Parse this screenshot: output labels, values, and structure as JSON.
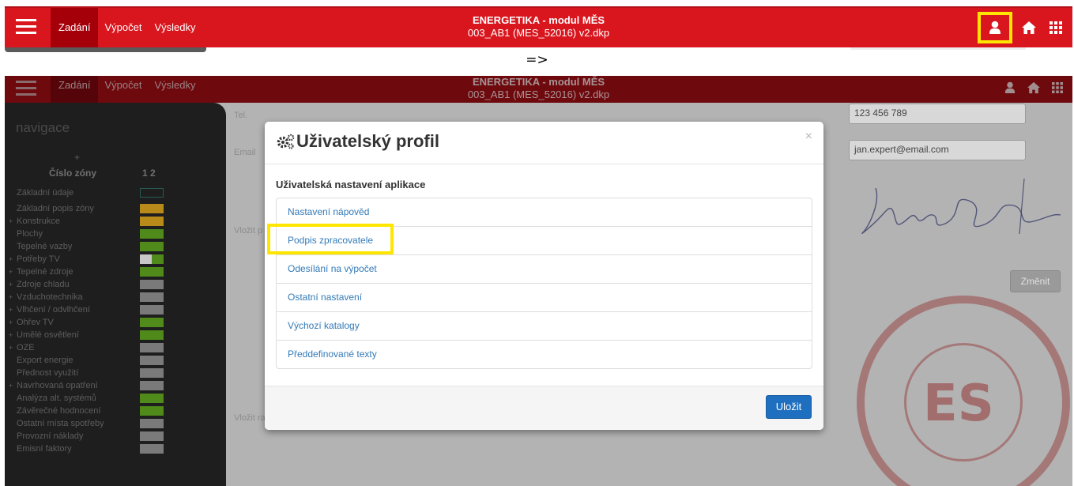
{
  "topbar": {
    "nav": [
      "Zadání",
      "Výpočet",
      "Výsledky"
    ],
    "title": "ENERGETIKA - modul MĚS",
    "subtitle": "003_AB1 (MES_52016) v2.dkp",
    "icons": [
      "menu-icon",
      "user-icon",
      "home-icon",
      "apps-grid-icon"
    ]
  },
  "arrow": "=>",
  "sidebar": {
    "title": "navigace",
    "plus": "+",
    "zone_header": "Číslo zóny",
    "zone_numbers": "1 2",
    "items": [
      {
        "label": "Základní údaje",
        "plus": ""
      },
      {
        "label": "Základní popis zóny",
        "plus": ""
      },
      {
        "label": "Konstrukce",
        "plus": "+"
      },
      {
        "label": "Plochy",
        "plus": ""
      },
      {
        "label": "Tepelné vazby",
        "plus": ""
      },
      {
        "label": "Potřeby TV",
        "plus": "+"
      },
      {
        "label": "Tepelné zdroje",
        "plus": "+"
      },
      {
        "label": "Zdroje chladu",
        "plus": "+"
      },
      {
        "label": "Vzduchotechnika",
        "plus": "+"
      },
      {
        "label": "Vlhčení / odvlhčení",
        "plus": "+"
      },
      {
        "label": "Ohřev TV",
        "plus": "+"
      },
      {
        "label": "Umělé osvětlení",
        "plus": "+"
      },
      {
        "label": "OZE",
        "plus": "+"
      },
      {
        "label": "Export energie",
        "plus": ""
      },
      {
        "label": "Přednost využití",
        "plus": ""
      },
      {
        "label": "Navrhovaná opatření",
        "plus": "+"
      },
      {
        "label": "Analýza alt. systémů",
        "plus": ""
      },
      {
        "label": "Závěrečné hodnocení",
        "plus": ""
      },
      {
        "label": "Ostatní místa spotřeby",
        "plus": ""
      },
      {
        "label": "Provozní náklady",
        "plus": ""
      },
      {
        "label": "Emisní faktory",
        "plus": ""
      }
    ]
  },
  "form": {
    "tel_label": "Tel.",
    "email_label": "Email",
    "vlozit_p_label": "Vložit p",
    "vlozit_ra_label": "Vložit ra",
    "tel_value": "123 456 789",
    "email_value": "jan.expert@email.com",
    "change_label": "Změnit"
  },
  "modal": {
    "title": "Uživatelský profil",
    "close": "×",
    "section": "Uživatelská nastavení aplikace",
    "items": [
      "Nastavení nápověd",
      "Podpis zpracovatele",
      "Odesílání na výpočet",
      "Ostatní nastavení",
      "Výchozí katalogy",
      "Předdefinované texty"
    ],
    "save_label": "Uložit"
  },
  "colors": {
    "brand_red": "#d9161e",
    "highlight": "#ffe600",
    "link_blue": "#337ab7",
    "primary_button": "#1f6fc0"
  }
}
